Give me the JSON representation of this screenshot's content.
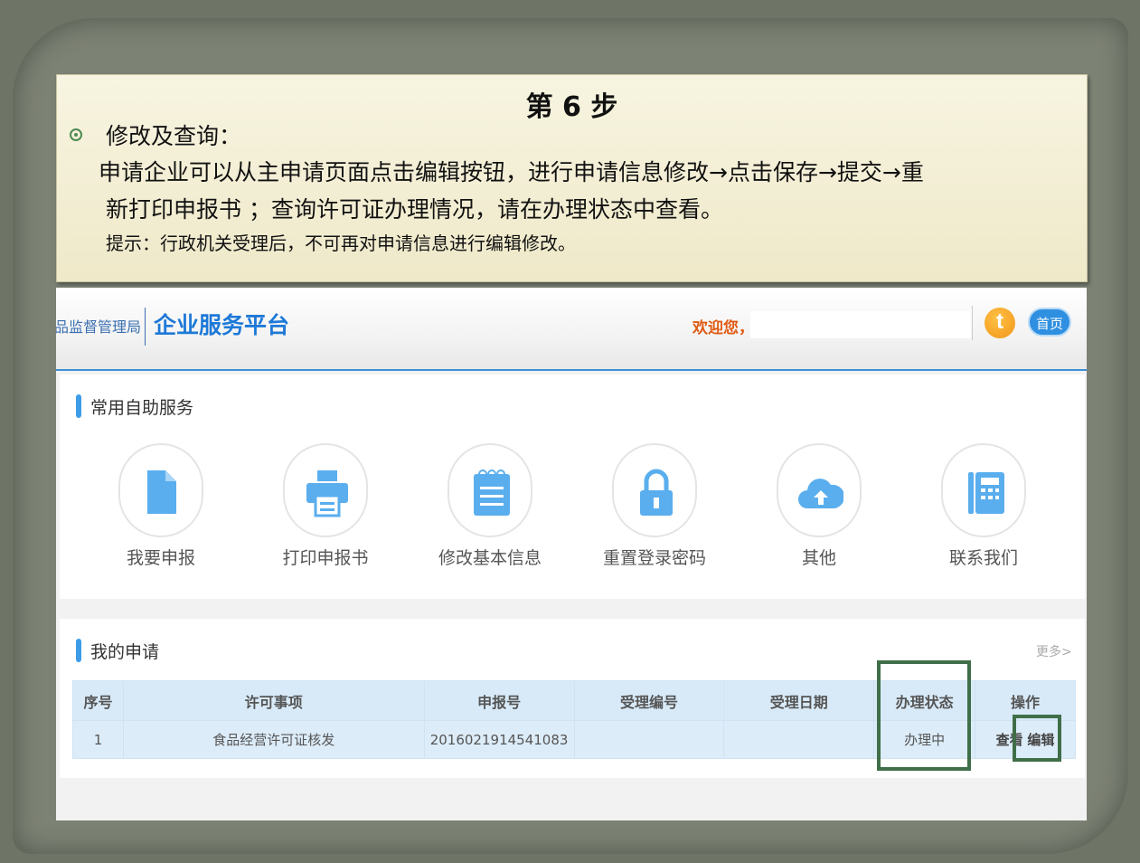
{
  "slide": {
    "step_title": "第 6 步",
    "bullet": "修改及查询：",
    "description_line1": "申请企业可以从主申请页面点击编辑按钮，进行申请信息修改→点击保存→提交→重",
    "description_line2": "新打印申报书 ；查询许可证办理情况，请在办理状态中查看。",
    "hint": "提示：行政机关受理后，不可再对申请信息进行编辑修改。"
  },
  "header": {
    "org_name": "品监督管理局",
    "platform_name": "企业服务平台",
    "welcome": "欢迎您，",
    "t_icon": "t",
    "home_button": "首页"
  },
  "self_service": {
    "title": "常用自助服务",
    "items": [
      {
        "label": "我要申报",
        "icon": "document-icon"
      },
      {
        "label": "打印申报书",
        "icon": "printer-icon"
      },
      {
        "label": "修改基本信息",
        "icon": "notepad-icon"
      },
      {
        "label": "重置登录密码",
        "icon": "lock-icon"
      },
      {
        "label": "其他",
        "icon": "cloud-upload-icon"
      },
      {
        "label": "联系我们",
        "icon": "phone-icon"
      }
    ]
  },
  "my_applications": {
    "title": "我的申请",
    "more": "更多>",
    "columns": [
      "序号",
      "许可事项",
      "申报号",
      "受理编号",
      "受理日期",
      "办理状态",
      "操作"
    ],
    "rows": [
      {
        "index": "1",
        "item": "食品经营许可证核发",
        "number": "2016021914541083",
        "acceptance_no": "",
        "acceptance_date": "",
        "status": "办理中",
        "view": "查看",
        "edit": "编辑"
      }
    ]
  },
  "colors": {
    "accent": "#1e79d8",
    "highlight_box": "#3f6e48",
    "welcome": "#e05a14"
  }
}
